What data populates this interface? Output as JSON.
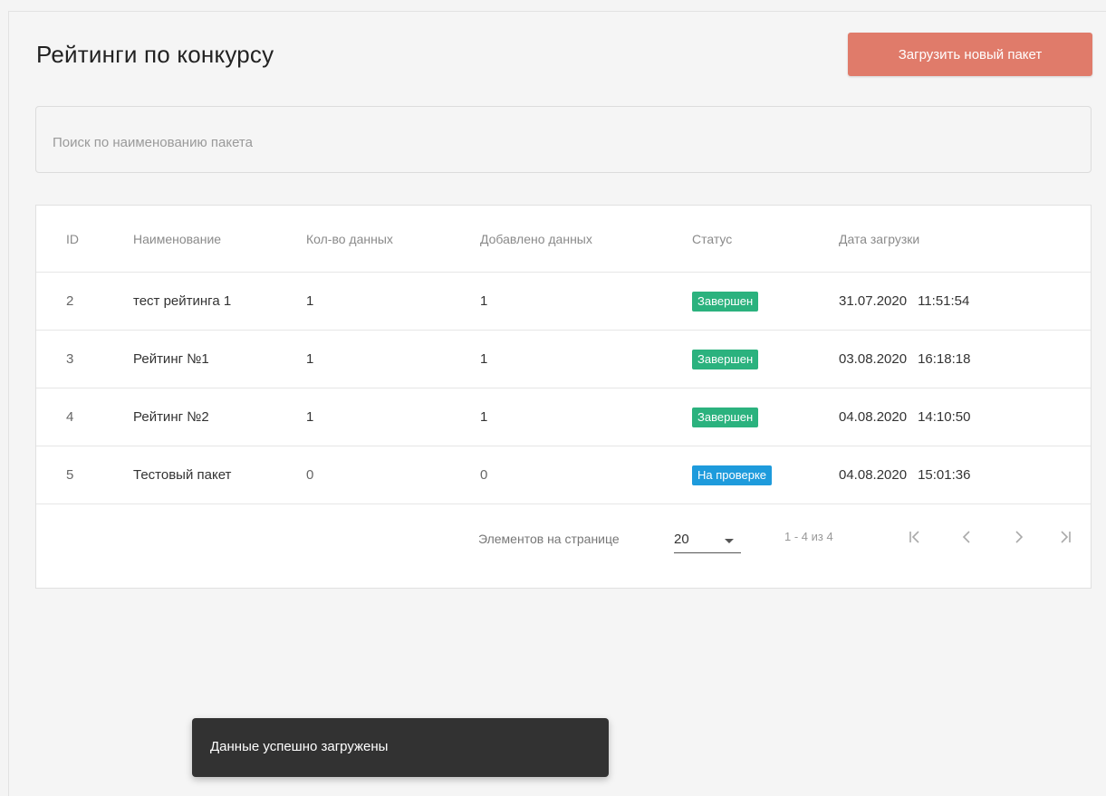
{
  "page": {
    "title": "Рейтинги по конкурсу",
    "upload_button": "Загрузить новый пакет"
  },
  "search": {
    "placeholder": "Поиск по наименованию пакета",
    "value": ""
  },
  "table": {
    "headers": {
      "id": "ID",
      "name": "Наименование",
      "total": "Кол-во данных",
      "added": "Добавлено данных",
      "status": "Статус",
      "date": "Дата загрузки"
    },
    "rows": [
      {
        "id": "2",
        "name": "тест рейтинга 1",
        "total": "1",
        "added": "1",
        "status": "Завершен",
        "date": "31.07.2020",
        "time": "11:51:54"
      },
      {
        "id": "3",
        "name": "Рейтинг №1",
        "total": "1",
        "added": "1",
        "status": "Завершен",
        "date": "03.08.2020",
        "time": "16:18:18"
      },
      {
        "id": "4",
        "name": "Рейтинг №2",
        "total": "1",
        "added": "1",
        "status": "Завершен",
        "date": "04.08.2020",
        "time": "14:10:50"
      },
      {
        "id": "5",
        "name": "Тестовый пакет",
        "total": "0",
        "added": "0",
        "status": "На проверке",
        "date": "04.08.2020",
        "time": "15:01:36"
      }
    ]
  },
  "paginator": {
    "label": "Элементов на странице",
    "page_size": "20",
    "range": "1 - 4 из 4",
    "icons": {
      "first": "first-page-icon",
      "prev": "chevron-left-icon",
      "next": "chevron-right-icon",
      "last": "last-page-icon"
    }
  },
  "toast": {
    "message": "Данные успешно загружены"
  },
  "colors": {
    "upload_button": "#e07b6a",
    "status_done": "#2bb27e",
    "status_check": "#1e9bdc",
    "toast_bg": "#323232"
  }
}
